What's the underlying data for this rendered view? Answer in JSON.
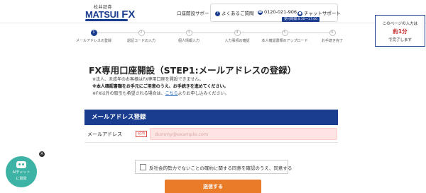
{
  "header": {
    "logo_sub": "松井証券",
    "logo_main": "MATSUI",
    "logo_fx": "FX",
    "open_support_link": "口座開設サポート",
    "faq": "よくあるご質問",
    "phone": "0120-021-906",
    "chat_support": "チャットサポート",
    "hours": "受付時間 8:30～17:00"
  },
  "side_notice": {
    "line1": "このページの入力は",
    "line2": "約1分",
    "line3": "で完了します"
  },
  "steps": [
    {
      "num": "1",
      "label": "メールアドレスの登録",
      "active": true
    },
    {
      "num": "2",
      "label": "認証コードの入力",
      "active": false
    },
    {
      "num": "3",
      "label": "個人情報入力",
      "active": false
    },
    {
      "num": "4",
      "label": "入力事項の確認",
      "active": false
    },
    {
      "num": "5",
      "label": "本人確認書類のアップロード",
      "active": false
    },
    {
      "num": "6",
      "label": "お手続き完了",
      "active": false
    }
  ],
  "main": {
    "title": "FX専用口座開設（STEP1:メールアドレスの登録）",
    "note1": "※法人、未成年のお客様はFX専用口座を開設できません。",
    "note2": "※本人確認書類をお手元にご用意のうえ、お手続きを進めてください。",
    "note3_pre": "※FX以外の取引も希望される場合は、",
    "note3_link": "こちら",
    "note3_post": "よりお申し込みください。"
  },
  "form": {
    "section_title": "メールアドレス登録",
    "email_label": "メールアドレス",
    "required_badge": "必須",
    "email_placeholder": "dummy@example.com",
    "email_value": ""
  },
  "consent": {
    "label": "反社会的勢力でないことの確約に関する同意を確認のうえ、同意する",
    "checked": false
  },
  "submit": {
    "label": "送信する"
  },
  "ai_chat": {
    "line1": "AIチャット",
    "line2": "に質問",
    "close": "×"
  }
}
